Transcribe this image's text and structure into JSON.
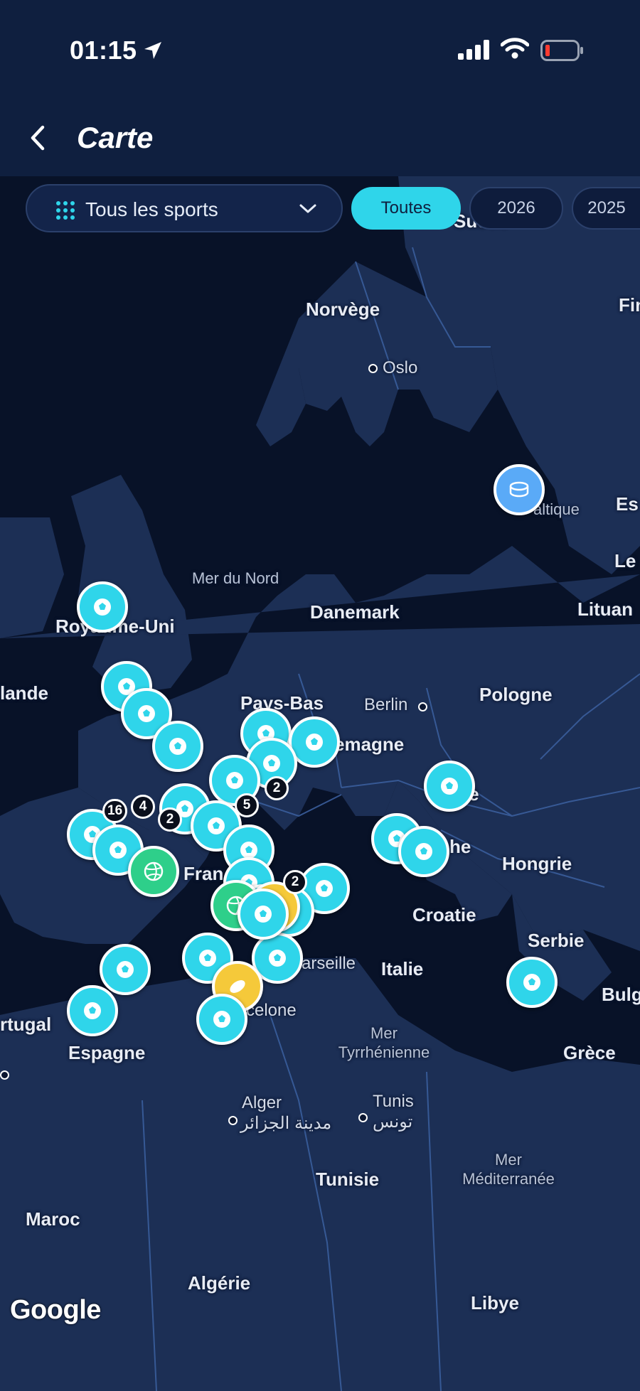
{
  "status_bar": {
    "time": "01:15"
  },
  "header": {
    "title": "Carte"
  },
  "filters": {
    "sport_select": "Tous les sports",
    "years": [
      "Toutes",
      "2026",
      "2025"
    ],
    "active_year": "Toutes"
  },
  "map": {
    "countries": [
      "Suède",
      "Norvège",
      "Danemark",
      "Royaume-Uni",
      "Pays-Bas",
      "Pologne",
      "Hongrie",
      "Croatie",
      "Serbie",
      "Italie",
      "Espagne",
      "Grèce",
      "Tunisie",
      "Maroc",
      "Algérie",
      "Libye",
      "lande",
      "rtugal",
      "Fin",
      "Es",
      "Le",
      "Lituan",
      "Bulg",
      "emagne",
      "Fran",
      "uie",
      "he"
    ],
    "cities": [
      "Oslo",
      "Berlin",
      "Marseille",
      "celone",
      "Alger",
      "مدينة الجزائر",
      "Tunis",
      "تونس"
    ],
    "seas": [
      "Mer du Nord",
      "altique",
      "Mer Tyrrhénienne",
      "Mer Méditerranée"
    ],
    "cluster_counts": [
      "16",
      "4",
      "2",
      "5",
      "2",
      "2"
    ],
    "attribution": "Google"
  },
  "colors": {
    "header_bg": "#0f1f3f",
    "accent": "#2fd5ea",
    "map_land": "#1c2f55",
    "map_water": "#081228"
  }
}
